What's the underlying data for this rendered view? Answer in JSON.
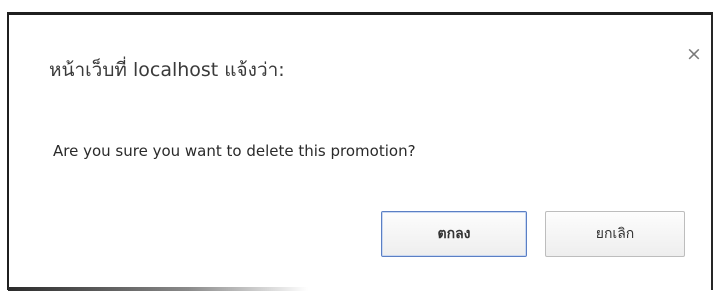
{
  "dialog": {
    "title": "หน้าเว็บที่ localhost แจ้งว่า:",
    "close_icon": "close-icon",
    "close_glyph": "×",
    "message": "Are you sure you want to delete this promotion?",
    "ok_label": "ตกลง",
    "cancel_label": "ยกเลิก",
    "colors": {
      "ok_border": "#5b7fc4",
      "text": "#3a3a3a"
    }
  }
}
